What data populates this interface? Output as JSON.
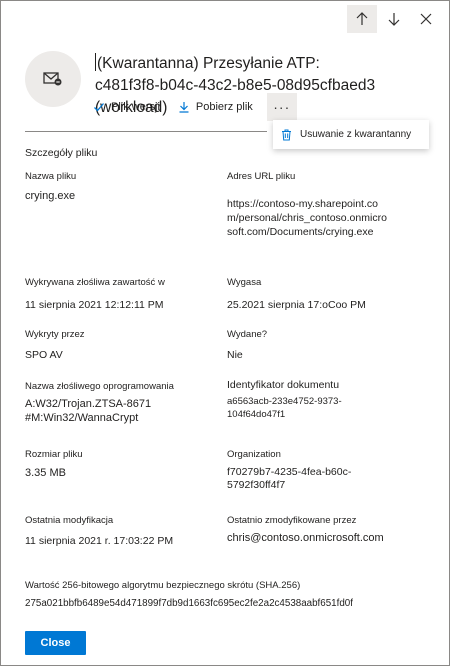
{
  "header": {
    "title": "(Kwarantanna) Przesyłanie ATP: c481f3f8-b04c-43c2-b8e5-08d95cfbaed3 (workload)"
  },
  "nav": {
    "up_icon": "arrow-up-icon",
    "down_icon": "arrow-down-icon",
    "close_icon": "close-icon"
  },
  "toolbar": {
    "versions_label": "Plik wersji",
    "download_label": "Pobierz plik",
    "more_label": "···"
  },
  "menu": {
    "remove_label": "Usuwanie z kwarantanny"
  },
  "details": {
    "section_title": "Szczegóły pliku",
    "file_name_label": "Nazwa pliku",
    "file_name": "crying.exe",
    "url_label": "Adres URL pliku",
    "url": "https://contoso-my.sharepoint.com/personal/chris_contoso.onmicrosoft.com/Documents/crying.exe",
    "detected_label": "Wykrywana złośliwa zawartość w",
    "detected": "11 sierpnia 2021 12:12:11 PM",
    "expires_label": "Wygasa",
    "expires": "25.2021 sierpnia 17:oCoo PM",
    "detected_by_label": "Wykryty przez",
    "detected_by": "SPO AV",
    "released_label": "Wydane?",
    "released": "Nie",
    "malware_label": "Nazwa złośliwego oprogramowania",
    "malware": "A:W32/Trojan.ZTSA-8671 #M:Win32/WannaCrypt",
    "doc_id_label": "Identyfikator dokumentu",
    "doc_id": "a6563acb-233e4752-9373-104f64do47f1",
    "size_label": "Rozmiar pliku",
    "size": "3.35 MB",
    "org_label": "Organization",
    "org": "f70279b7-4235-4fea-b60c-5792f30ff4f7",
    "modified_label": "Ostatnia modyfikacja",
    "modified": "11 sierpnia 2021 r. 17:03:22 PM",
    "modified_by_label": "Ostatnio zmodyfikowane przez",
    "modified_by": "chris@contoso.onmicrosoft.com",
    "sha_label": "Wartość 256-bitowego algorytmu bezpiecznego skrótu (SHA.256)",
    "sha": "275a021bbfb6489e54d471899f7db9d1663fc695ec2fe2a2c4538aabf651fd0f"
  },
  "footer": {
    "close_label": "Close"
  },
  "colors": {
    "accent": "#0078d4",
    "avatar_bg": "#edebe9"
  }
}
